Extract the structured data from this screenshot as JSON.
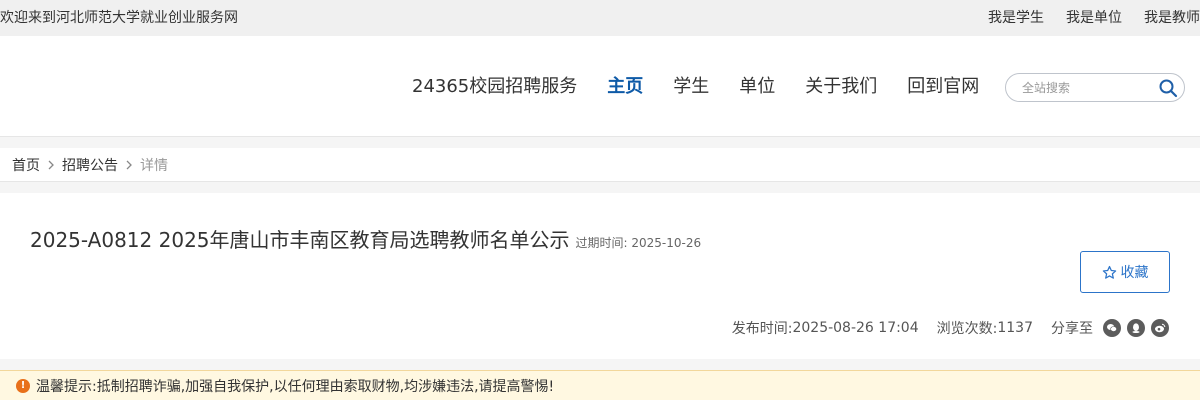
{
  "topbar": {
    "welcome": "欢迎来到河北师范大学就业创业服务网",
    "links": [
      "我是学生",
      "我是单位",
      "我是教师"
    ]
  },
  "nav": {
    "items": [
      {
        "label": "24365校园招聘服务",
        "active": false
      },
      {
        "label": "主页",
        "active": true
      },
      {
        "label": "学生",
        "active": false
      },
      {
        "label": "单位",
        "active": false
      },
      {
        "label": "关于我们",
        "active": false
      },
      {
        "label": "回到官网",
        "active": false
      }
    ]
  },
  "search": {
    "placeholder": "全站搜索",
    "value": ""
  },
  "breadcrumb": {
    "home": "首页",
    "section": "招聘公告",
    "current": "详情"
  },
  "article": {
    "title": "2025-A0812 2025年唐山市丰南区教育局选聘教师名单公示",
    "expire_label": "过期时间:",
    "expire_date": "2025-10-26",
    "collect_label": "收藏",
    "publish_label": "发布时间:",
    "publish_time": "2025-08-26 17:04",
    "views_label": "浏览次数:",
    "views": "1137",
    "share_label": "分享至"
  },
  "share": {
    "icons": [
      "wechat-icon",
      "qq-icon",
      "weibo-icon"
    ]
  },
  "notice": {
    "text": "温馨提示:抵制招聘诈骗,加强自我保护,以任何理由索取财物,均涉嫌违法,请提高警惕!"
  },
  "colors": {
    "accent": "#0e5aa7",
    "button": "#2c74c9",
    "warning": "#e8701a",
    "notice_bg": "#fff8e1"
  }
}
